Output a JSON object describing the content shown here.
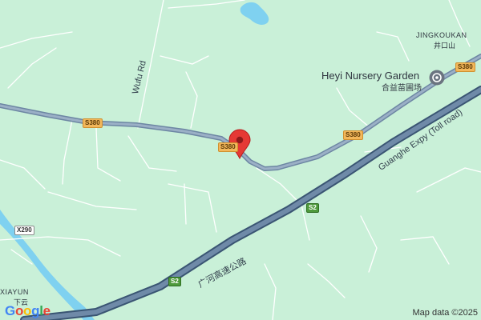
{
  "map": {
    "background_color": "#c9f0d8",
    "water_color": "#7fd1f0",
    "road_color": "#8ca3bc",
    "highway_color": "#5c7694",
    "pin_color": "#e53935"
  },
  "labels": {
    "place_jingkoukan": "JINGKOUKAN",
    "place_jingkoukan_zh": "井口山",
    "place_xiayun": "XIAYUN",
    "place_xiayun_zh": "下云",
    "poi_name": "Heyi Nursery Garden",
    "poi_name_zh": "合益苗圃场",
    "road_wufu": "Wufu Rd",
    "expressway_en": "Guanghe Expy (Toll road)",
    "expressway_zh": "广河高速公路"
  },
  "shields": {
    "s380": "S380",
    "s2": "S2",
    "x290": "X290"
  },
  "footer": {
    "logo": "Google",
    "attribution": "Map data ©2025"
  },
  "icons": {
    "pin": "map-pin-icon",
    "poi": "place-of-interest-icon"
  }
}
